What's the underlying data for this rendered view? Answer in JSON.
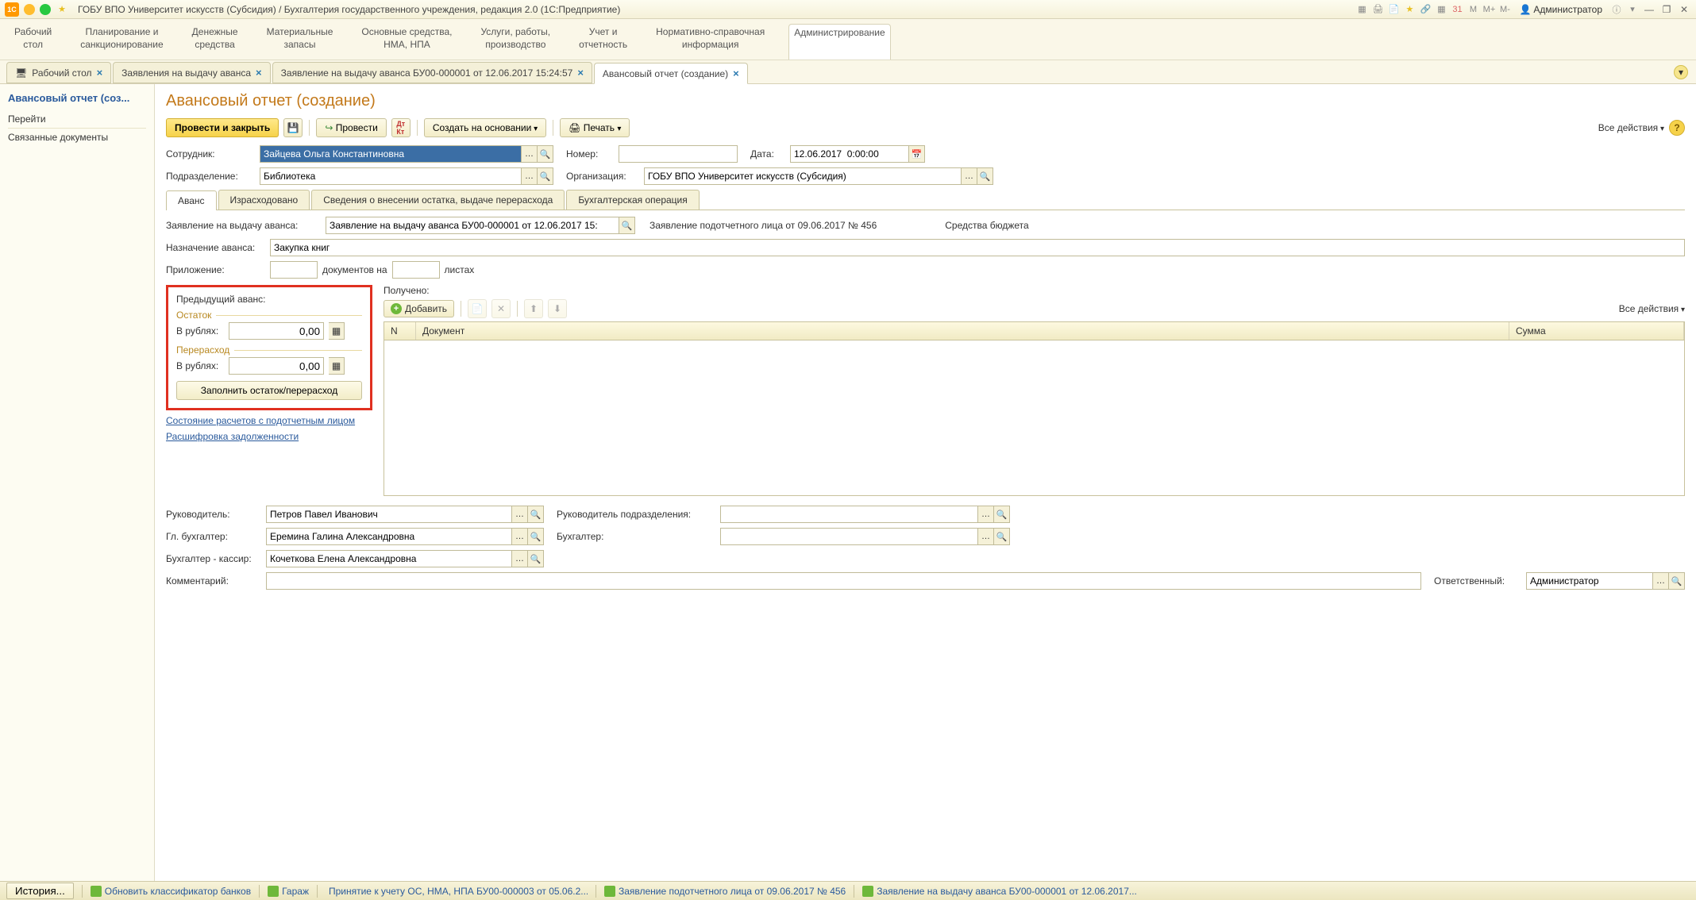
{
  "titlebar": {
    "title": "ГОБУ ВПО Университет искусств (Субсидия) / Бухгалтерия государственного учреждения, редакция 2.0  (1С:Предприятие)",
    "m_label": "M",
    "mplus": "M+",
    "mminus": "M-",
    "user": "Администратор"
  },
  "mainmenu": {
    "items": [
      "Рабочий\nстол",
      "Планирование и\nсанкционирование",
      "Денежные\nсредства",
      "Материальные\nзапасы",
      "Основные средства,\nНМА, НПА",
      "Услуги, работы,\nпроизводство",
      "Учет и\nотчетность",
      "Нормативно-справочная\nинформация",
      "Администрирование"
    ]
  },
  "doctabs": {
    "tabs": [
      "Рабочий стол",
      "Заявления на выдачу аванса",
      "Заявление на выдачу аванса БУ00-000001 от 12.06.2017 15:24:57",
      "Авансовый отчет (создание)"
    ]
  },
  "sidebar": {
    "title": "Авансовый отчет (соз...",
    "section": "Перейти",
    "link1": "Связанные документы"
  },
  "page": {
    "title": "Авансовый отчет (создание)",
    "toolbar": {
      "provesti_close": "Провести и закрыть",
      "provesti": "Провести",
      "create_based": "Создать на основании",
      "print": "Печать",
      "all_actions": "Все действия"
    }
  },
  "fields": {
    "employee_lbl": "Сотрудник:",
    "employee": "Зайцева Ольга Константиновна",
    "number_lbl": "Номер:",
    "number": "",
    "date_lbl": "Дата:",
    "date": "12.06.2017  0:00:00",
    "dept_lbl": "Подразделение:",
    "dept": "Библиотека",
    "org_lbl": "Организация:",
    "org": "ГОБУ ВПО Университет искусств (Субсидия)"
  },
  "innertabs": {
    "t1": "Аванс",
    "t2": "Израсходовано",
    "t3": "Сведения о внесении остатка, выдаче перерасхода",
    "t4": "Бухгалтерская операция"
  },
  "advance": {
    "request_lbl": "Заявление на выдачу аванса:",
    "request": "Заявление на выдачу аванса БУ00-000001 от 12.06.2017 15:",
    "subrequest_text": "Заявление подотчетного лица от 09.06.2017 № 456",
    "funds_text": "Средства бюджета",
    "purpose_lbl": "Назначение аванса:",
    "purpose": "Закупка книг",
    "attach_lbl": "Приложение:",
    "attach_docs": "документов на",
    "attach_sheets": "листах",
    "prev_title": "Предыдущий аванс:",
    "remainder": "Остаток",
    "rub_lbl": "В рублях:",
    "rub_val": "0,00",
    "overrun": "Перерасход",
    "fill_btn": "Заполнить остаток/перерасход",
    "link1": "Состояние расчетов с подотчетным лицом",
    "link2": "Расшифровка задолженности",
    "received_lbl": "Получено:",
    "add_btn": "Добавить",
    "all_actions": "Все действия",
    "col_n": "N",
    "col_doc": "Документ",
    "col_sum": "Сумма"
  },
  "bottom": {
    "head_lbl": "Руководитель:",
    "head": "Петров Павел Иванович",
    "depthead_lbl": "Руководитель подразделения:",
    "glbuh_lbl": "Гл. бухгалтер:",
    "glbuh": "Еремина Галина Александровна",
    "buh_lbl": "Бухгалтер:",
    "cashier_lbl": "Бухгалтер - кассир:",
    "cashier": "Кочеткова Елена Александровна",
    "comment_lbl": "Комментарий:",
    "resp_lbl": "Ответственный:",
    "resp": "Администратор"
  },
  "statusbar": {
    "history": "История...",
    "i1": "Обновить классификатор банков",
    "i2": "Гараж",
    "i3": "Принятие к учету ОС, НМА, НПА БУ00-000003 от 05.06.2...",
    "i4": "Заявление подотчетного лица от 09.06.2017 № 456",
    "i5": "Заявление на выдачу аванса БУ00-000001 от 12.06.2017..."
  }
}
